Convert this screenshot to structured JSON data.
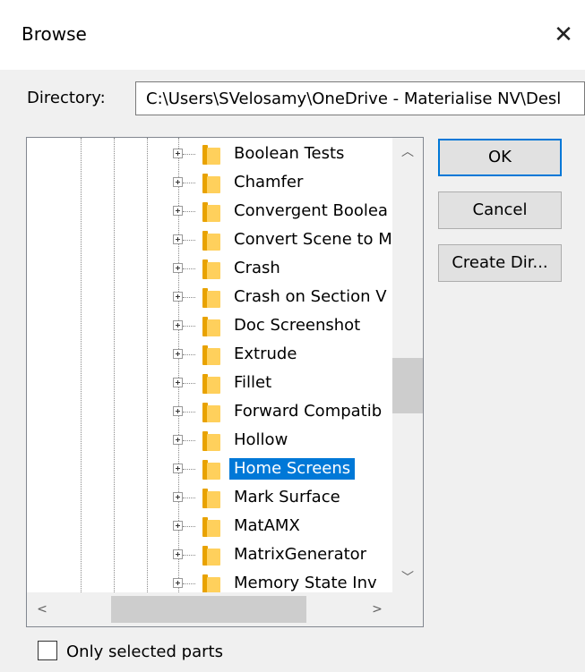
{
  "window": {
    "title": "Browse",
    "close_glyph": "✕"
  },
  "directory": {
    "label": "Directory:",
    "value": "C:\\Users\\SVelosamy\\OneDrive - Materialise NV\\Desl"
  },
  "tree": {
    "items": [
      {
        "label": "Boolean Tests",
        "selected": false
      },
      {
        "label": "Chamfer",
        "selected": false
      },
      {
        "label": "Convergent Boolea",
        "selected": false
      },
      {
        "label": "Convert Scene to M",
        "selected": false
      },
      {
        "label": "Crash",
        "selected": false
      },
      {
        "label": "Crash on Section V",
        "selected": false
      },
      {
        "label": "Doc Screenshot",
        "selected": false
      },
      {
        "label": "Extrude",
        "selected": false
      },
      {
        "label": "Fillet",
        "selected": false
      },
      {
        "label": "Forward Compatib",
        "selected": false
      },
      {
        "label": "Hollow",
        "selected": false
      },
      {
        "label": "Home Screens",
        "selected": true
      },
      {
        "label": "Mark Surface",
        "selected": false
      },
      {
        "label": "MatAMX",
        "selected": false
      },
      {
        "label": "MatrixGenerator",
        "selected": false
      },
      {
        "label": "Memory State Inv",
        "selected": false
      }
    ],
    "scroll": {
      "up_icon": "chevron-up-icon",
      "down_icon": "chevron-down-icon",
      "left_icon": "chevron-left-icon",
      "right_icon": "chevron-right-icon",
      "up_glyph": "︿",
      "down_glyph": "﹀",
      "left_glyph": "<",
      "right_glyph": ">"
    }
  },
  "buttons": {
    "ok": "OK",
    "cancel": "Cancel",
    "create_dir": "Create Dir..."
  },
  "options": {
    "only_selected_label": "Only selected parts",
    "only_selected_checked": false
  },
  "colors": {
    "selection": "#0078d7",
    "folder": "#ffd05c",
    "default_button_border": "#0078d7"
  }
}
